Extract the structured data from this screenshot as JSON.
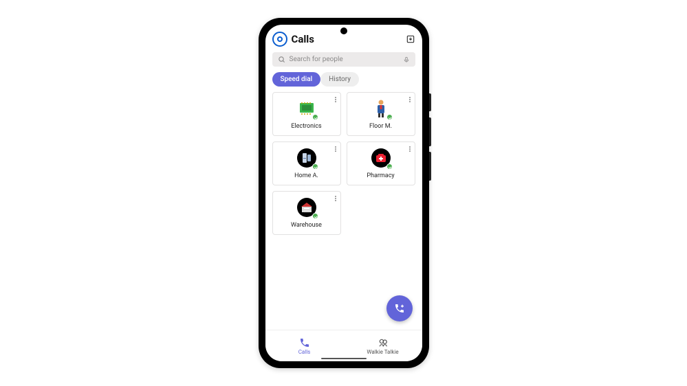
{
  "header": {
    "title": "Calls"
  },
  "search": {
    "placeholder": "Search for people"
  },
  "tabs": {
    "speed_dial": "Speed dial",
    "history": "History"
  },
  "contacts": [
    {
      "label": "Electronics",
      "icon": "electronics"
    },
    {
      "label": "Floor M.",
      "icon": "person"
    },
    {
      "label": "Home A.",
      "icon": "home-appliance"
    },
    {
      "label": "Pharmacy",
      "icon": "pharmacy"
    },
    {
      "label": "Warehouse",
      "icon": "warehouse"
    }
  ],
  "nav": {
    "calls": "Calls",
    "walkie": "Walkie Talkie"
  }
}
